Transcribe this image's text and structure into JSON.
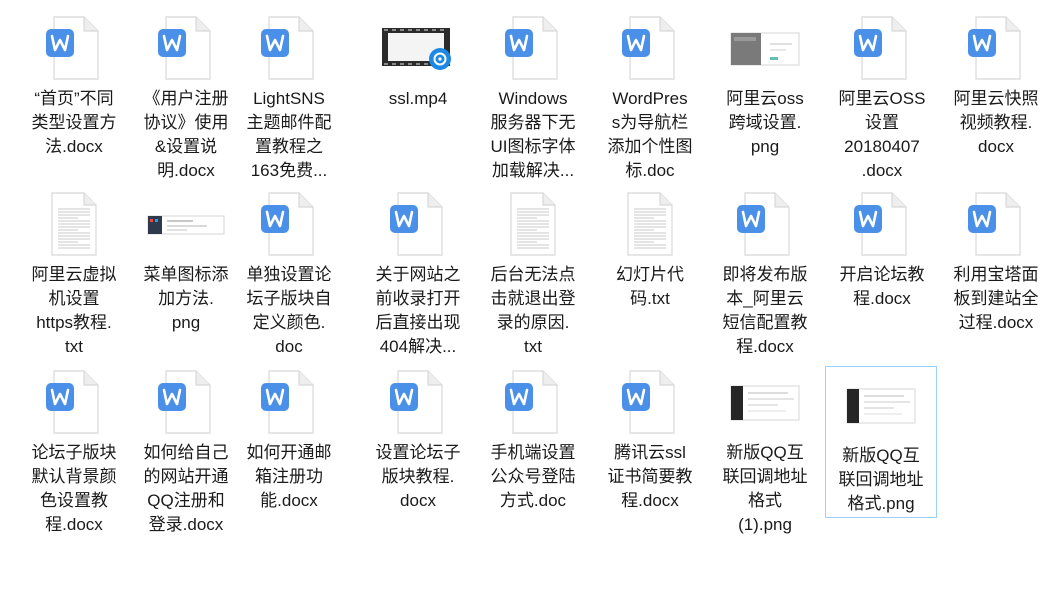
{
  "files": [
    {
      "name": "“首页”不同\n类型设置方\n法.docx",
      "icon": "word-doc-icon"
    },
    {
      "name": "《用户注册\n协议》使用\n&设置说\n明.docx",
      "icon": "word-doc-icon"
    },
    {
      "name": "LightSNS\n主题邮件配\n置教程之\n163免费...",
      "icon": "word-doc-icon"
    },
    {
      "name": "ssl.mp4",
      "icon": "video-file-icon"
    },
    {
      "name": "Windows\n服务器下无\nUI图标字体\n加载解决...",
      "icon": "word-doc-icon"
    },
    {
      "name": "WordPres\ns为导航栏\n添加个性图\n标.doc",
      "icon": "word-doc-icon"
    },
    {
      "name": "阿里云oss\n跨域设置.\npng",
      "icon": "image-thumbnail-icon"
    },
    {
      "name": "阿里云OSS\n设置\n20180407\n.docx",
      "icon": "word-doc-icon"
    },
    {
      "name": "阿里云快照\n视频教程.\ndocx",
      "icon": "word-doc-icon"
    },
    {
      "name": "阿里云虚拟\n机设置\nhttps教程.\ntxt",
      "icon": "text-file-icon"
    },
    {
      "name": "菜单图标添\n加方法.\npng",
      "icon": "image-thumbnail-icon"
    },
    {
      "name": "单独设置论\n坛子版块自\n定义颜色.\ndoc",
      "icon": "word-doc-icon"
    },
    {
      "name": "关于网站之\n前收录打开\n后直接出现\n404解决...",
      "icon": "word-doc-icon"
    },
    {
      "name": "后台无法点\n击就退出登\n录的原因.\ntxt",
      "icon": "text-file-icon"
    },
    {
      "name": "幻灯片代\n码.txt",
      "icon": "text-file-icon"
    },
    {
      "name": "即将发布版\n本_阿里云\n短信配置教\n程.docx",
      "icon": "word-doc-icon"
    },
    {
      "name": "开启论坛教\n程.docx",
      "icon": "word-doc-icon"
    },
    {
      "name": "利用宝塔面\n板到建站全\n过程.docx",
      "icon": "word-doc-icon"
    },
    {
      "name": "论坛子版块\n默认背景颜\n色设置教\n程.docx",
      "icon": "word-doc-icon"
    },
    {
      "name": "如何给自己\n的网站开通\nQQ注册和\n登录.docx",
      "icon": "word-doc-icon"
    },
    {
      "name": "如何开通邮\n箱注册功\n能.docx",
      "icon": "word-doc-icon"
    },
    {
      "name": "设置论坛子\n版块教程.\ndocx",
      "icon": "word-doc-icon"
    },
    {
      "name": "手机端设置\n公众号登陆\n方式.doc",
      "icon": "word-doc-icon"
    },
    {
      "name": "腾讯云ssl\n证书简要教\n程.docx",
      "icon": "word-doc-icon"
    },
    {
      "name": "新版QQ互\n联回调地址\n格式\n(1).png",
      "icon": "image-thumbnail-icon"
    },
    {
      "name": "新版QQ互\n联回调地址\n格式.png",
      "icon": "image-thumbnail-icon",
      "selected": true
    }
  ],
  "colors": {
    "word_blue": "#4a8fe8",
    "selection_border": "#99d1ff"
  }
}
